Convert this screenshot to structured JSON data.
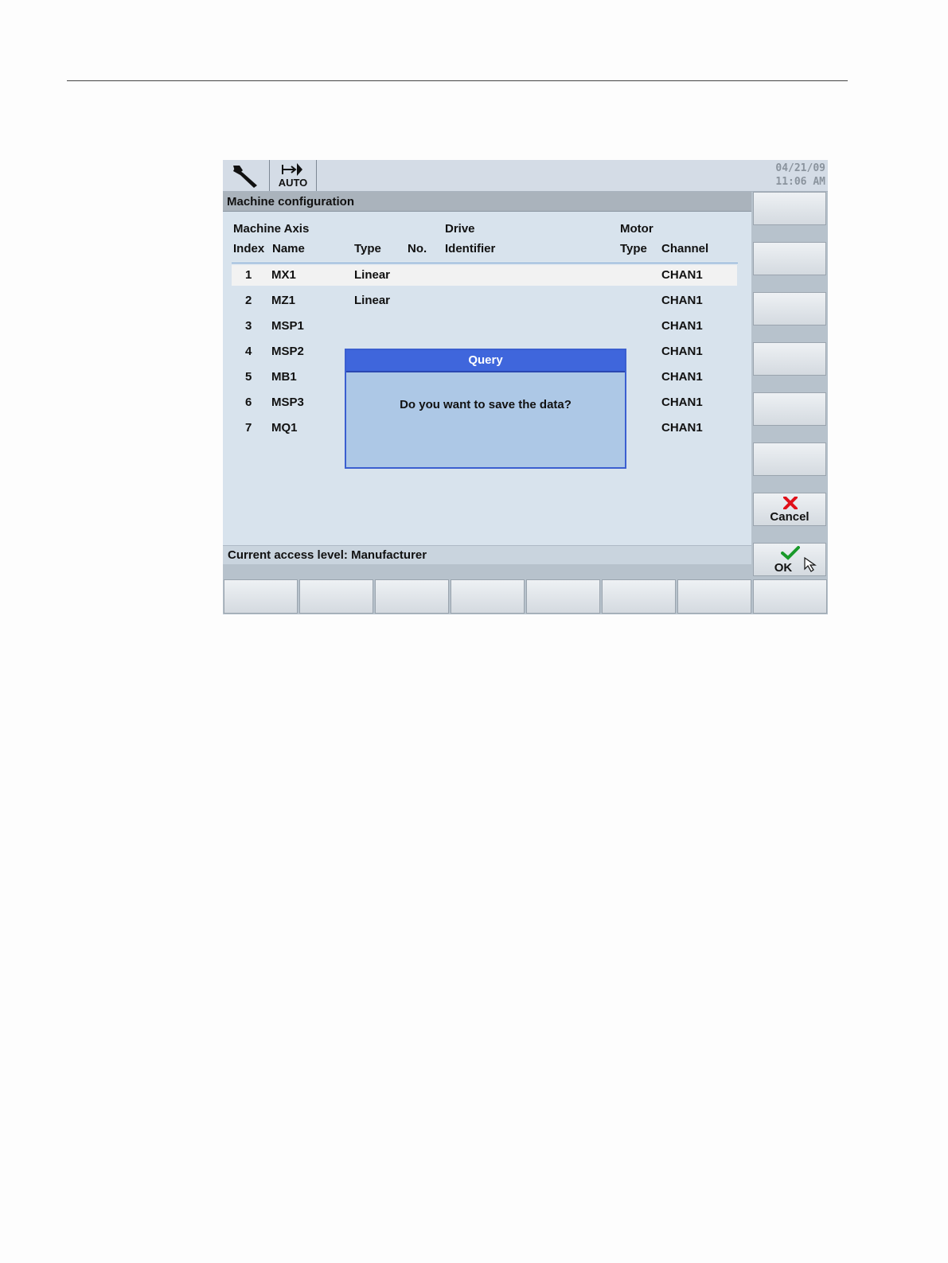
{
  "header": {
    "date": "04/21/09",
    "time": "11:06 AM",
    "mode_label": "AUTO"
  },
  "window": {
    "title": "Machine configuration"
  },
  "table": {
    "group_headers": {
      "machine_axis": "Machine Axis",
      "drive": "Drive",
      "motor": "Motor"
    },
    "columns": {
      "index": "Index",
      "name": "Name",
      "type": "Type",
      "no": "No.",
      "identifier": "Identifier",
      "motor_type": "Type",
      "channel": "Channel"
    },
    "rows": [
      {
        "index": "1",
        "name": "MX1",
        "type": "Linear",
        "channel": "CHAN1"
      },
      {
        "index": "2",
        "name": "MZ1",
        "type": "Linear",
        "channel": "CHAN1"
      },
      {
        "index": "3",
        "name": "MSP1",
        "type": "",
        "channel": "CHAN1"
      },
      {
        "index": "4",
        "name": "MSP2",
        "type": "",
        "channel": "CHAN1"
      },
      {
        "index": "5",
        "name": "MB1",
        "type": "",
        "channel": "CHAN1"
      },
      {
        "index": "6",
        "name": "MSP3",
        "type": "",
        "channel": "CHAN1"
      },
      {
        "index": "7",
        "name": "MQ1",
        "type": "",
        "channel": "CHAN1"
      }
    ]
  },
  "dialog": {
    "title": "Query",
    "message": "Do you want to save the data?"
  },
  "status": {
    "text": "Current access level: Manufacturer"
  },
  "softkeys": {
    "cancel_label": "Cancel",
    "ok_label": "OK"
  },
  "colors": {
    "dialog_title_bar": "#3f66dc",
    "cancel_icon": "#e0101a",
    "ok_icon": "#1a9a2a"
  }
}
